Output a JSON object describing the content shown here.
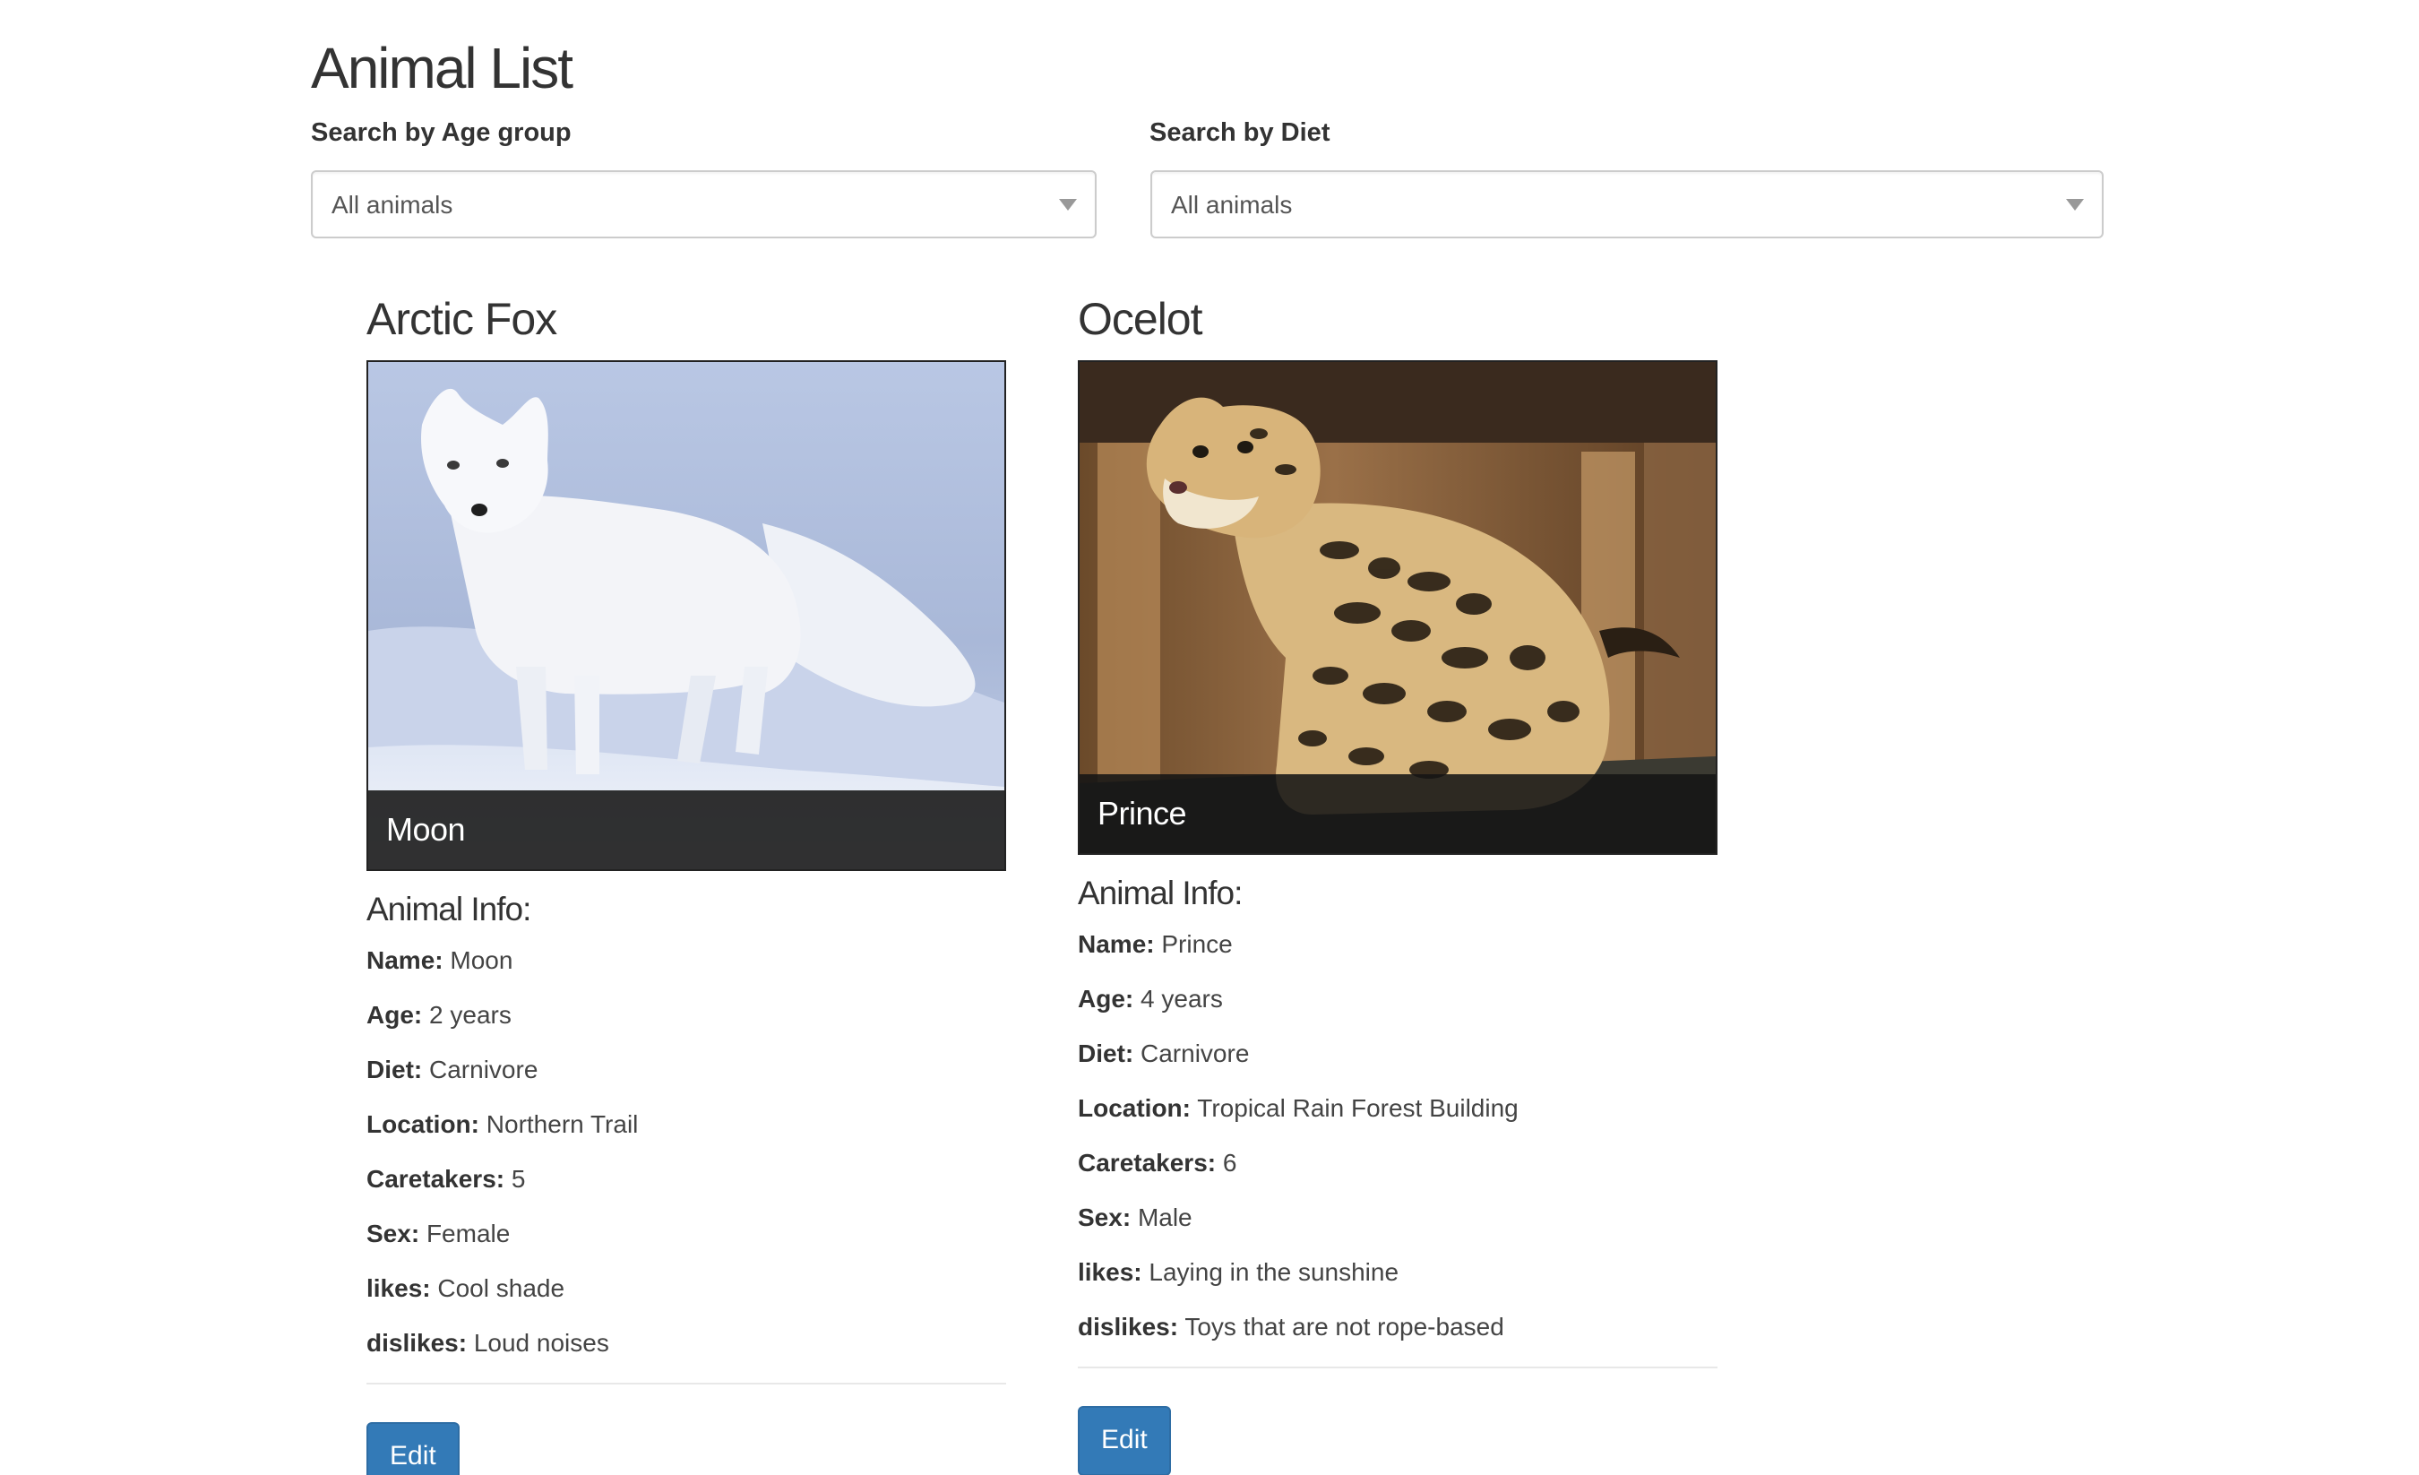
{
  "page": {
    "title": "Animal List"
  },
  "filters": {
    "age": {
      "label": "Search by Age group",
      "selected": "All animals"
    },
    "diet": {
      "label": "Search by Diet",
      "selected": "All animals"
    }
  },
  "animals": [
    {
      "species": "Arctic Fox",
      "caption": "Moon",
      "info_heading": "Animal Info:",
      "fields": [
        {
          "key": "Name:",
          "value": "Moon"
        },
        {
          "key": "Age:",
          "value": "2 years"
        },
        {
          "key": "Diet:",
          "value": "Carnivore"
        },
        {
          "key": "Location:",
          "value": "Northern Trail"
        },
        {
          "key": "Caretakers:",
          "value": "5"
        },
        {
          "key": "Sex:",
          "value": "Female"
        },
        {
          "key": "likes:",
          "value": "Cool shade"
        },
        {
          "key": "dislikes:",
          "value": "Loud noises"
        }
      ],
      "edit_label": "Edit"
    },
    {
      "species": "Ocelot",
      "caption": "Prince",
      "info_heading": "Animal Info:",
      "fields": [
        {
          "key": "Name:",
          "value": "Prince"
        },
        {
          "key": "Age:",
          "value": "4 years"
        },
        {
          "key": "Diet:",
          "value": "Carnivore"
        },
        {
          "key": "Location:",
          "value": "Tropical Rain Forest Building"
        },
        {
          "key": "Caretakers:",
          "value": "6"
        },
        {
          "key": "Sex:",
          "value": "Male"
        },
        {
          "key": "likes:",
          "value": "Laying in the sunshine"
        },
        {
          "key": "dislikes:",
          "value": "Toys that are not rope-based"
        }
      ],
      "edit_label": "Edit"
    }
  ],
  "colors": {
    "primary_button": "#337ab7",
    "text": "#333333",
    "caption_overlay": "#141414"
  }
}
